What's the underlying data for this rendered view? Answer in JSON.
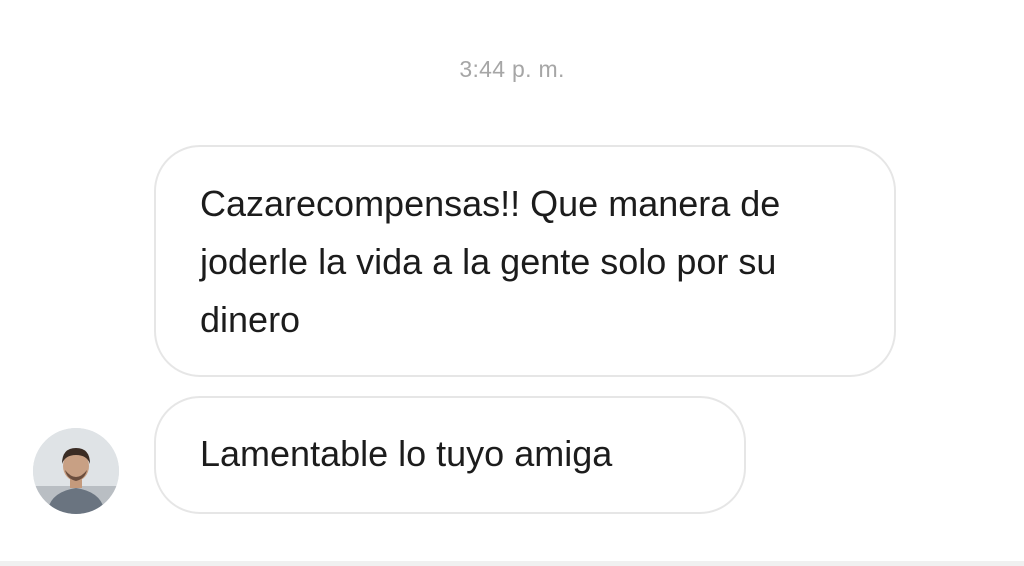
{
  "conversation": {
    "timestamp": "3:44 p. m.",
    "messages": [
      {
        "text": "Cazarecompensas!! Que manera de joderle la vida a la gente solo por su dinero",
        "sender": "other"
      },
      {
        "text": "Lamentable lo tuyo amiga",
        "sender": "other",
        "show_avatar": true
      }
    ]
  },
  "colors": {
    "background": "#ffffff",
    "bubble_border": "#e6e6e6",
    "message_text": "#1c1c1c",
    "timestamp_text": "#a6a6a6"
  },
  "icons": {
    "avatar": "profile-photo"
  }
}
